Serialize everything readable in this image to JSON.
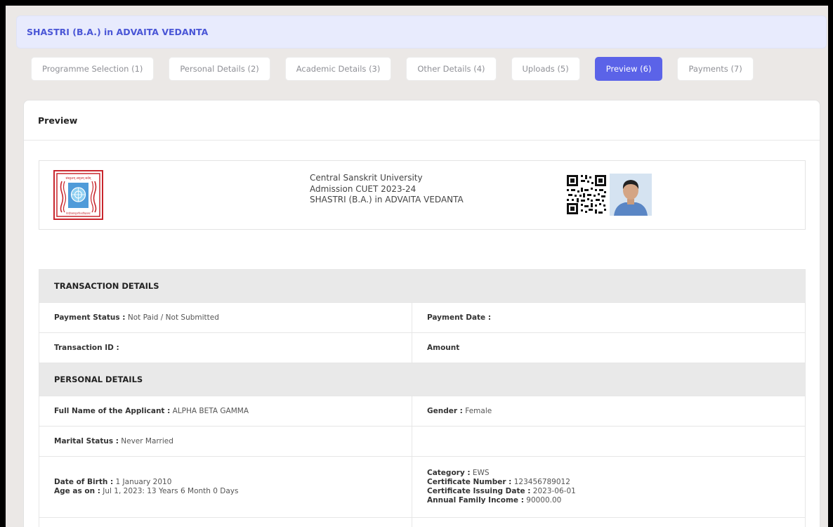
{
  "programme": {
    "title": "SHASTRI (B.A.) in ADVAITA VEDANTA"
  },
  "tabs": [
    {
      "label": "Programme Selection (1)",
      "active": false
    },
    {
      "label": "Personal Details (2)",
      "active": false
    },
    {
      "label": "Academic Details (3)",
      "active": false
    },
    {
      "label": "Other Details (4)",
      "active": false
    },
    {
      "label": "Uploads (5)",
      "active": false
    },
    {
      "label": "Preview (6)",
      "active": true
    },
    {
      "label": "Payments (7)",
      "active": false
    }
  ],
  "preview": {
    "title": "Preview",
    "letterhead": {
      "university": "Central Sanskrit University",
      "admission": "Admission CUET 2023-24",
      "programme": "SHASTRI (B.A.) in ADVAITA VEDANTA",
      "logo_text": "संस्कृतम् अमृतम् सर्वम्",
      "logo_footer": "केन्द्रीयसंस्कृतविश्वविद्यालयः"
    },
    "transaction": {
      "heading": "TRANSACTION DETAILS",
      "payment_status_label": "Payment Status :",
      "payment_status_value": "Not Paid / Not Submitted",
      "payment_date_label": "Payment Date :",
      "payment_date_value": "",
      "transaction_id_label": "Transaction ID :",
      "transaction_id_value": "",
      "amount_label": "Amount",
      "amount_value": ""
    },
    "personal": {
      "heading": "PERSONAL DETAILS",
      "full_name_label": "Full Name of the Applicant :",
      "full_name_value": "ALPHA BETA GAMMA",
      "gender_label": "Gender :",
      "gender_value": "Female",
      "marital_label": "Marital Status :",
      "marital_value": "Never Married",
      "dob_label": "Date of Birth :",
      "dob_value": "1 January 2010",
      "age_label": "Age as on :",
      "age_value": "Jul 1, 2023: 13 Years 6 Month 0 Days",
      "category_label": "Category :",
      "category_value": "EWS",
      "cert_no_label": "Certificate Number :",
      "cert_no_value": "123456789012",
      "cert_date_label": "Certificate Issuing Date :",
      "cert_date_value": "2023-06-01",
      "income_label": "Annual Family Income :",
      "income_value": "90000.00"
    }
  },
  "colors": {
    "accent": "#5b63e8",
    "header_bg": "#e8ebfd",
    "page_bg": "#ebe8e6",
    "logo_border": "#c8262d"
  }
}
